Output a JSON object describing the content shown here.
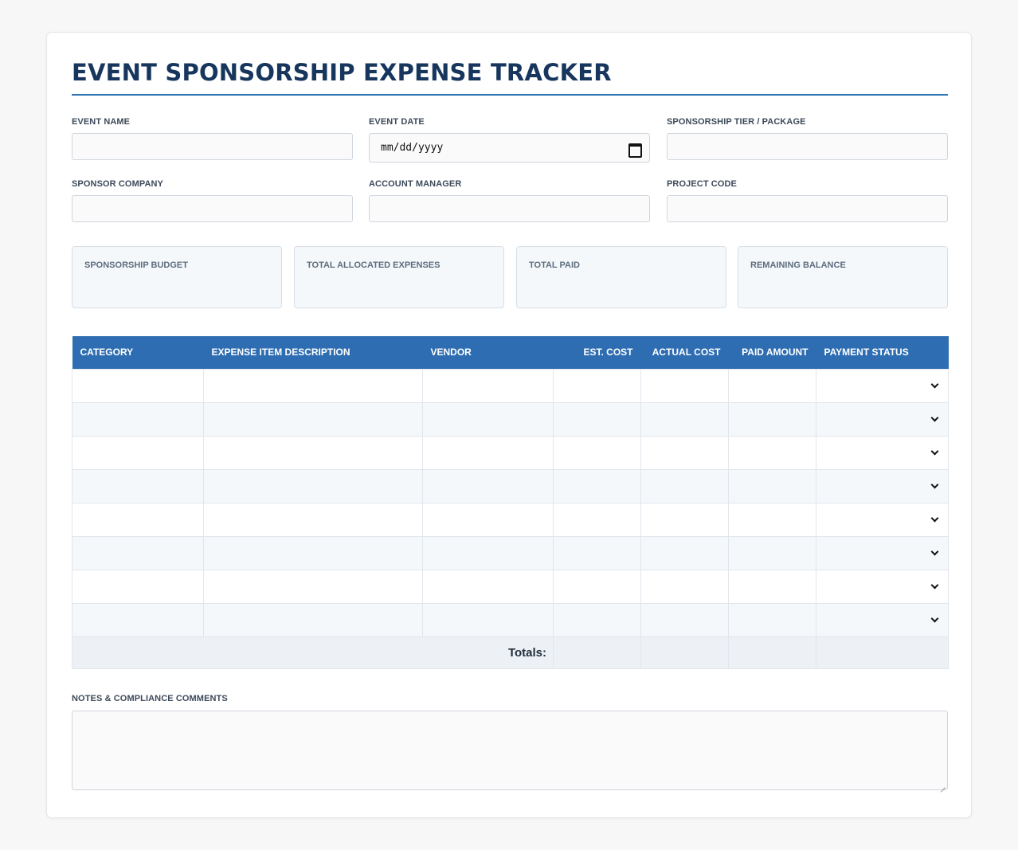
{
  "title": "EVENT SPONSORSHIP EXPENSE TRACKER",
  "fields": {
    "event_name": {
      "label": "EVENT NAME",
      "value": ""
    },
    "event_date": {
      "label": "EVENT DATE",
      "placeholder": "mm/dd/yyyy"
    },
    "tier": {
      "label": "SPONSORSHIP TIER / PACKAGE",
      "value": ""
    },
    "sponsor_company": {
      "label": "SPONSOR COMPANY",
      "value": ""
    },
    "account_manager": {
      "label": "ACCOUNT MANAGER",
      "value": ""
    },
    "project_code": {
      "label": "PROJECT CODE",
      "value": ""
    }
  },
  "summary": [
    {
      "label": "SPONSORSHIP BUDGET",
      "value": ""
    },
    {
      "label": "TOTAL ALLOCATED EXPENSES",
      "value": ""
    },
    {
      "label": "TOTAL PAID",
      "value": ""
    },
    {
      "label": "REMAINING BALANCE",
      "value": ""
    }
  ],
  "table": {
    "headers": [
      "CATEGORY",
      "EXPENSE ITEM DESCRIPTION",
      "VENDOR",
      "EST. COST",
      "ACTUAL COST",
      "PAID AMOUNT",
      "PAYMENT STATUS"
    ],
    "totals_label": "Totals:"
  },
  "notes": {
    "label": "NOTES & COMPLIANCE COMMENTS",
    "value": ""
  },
  "icons": {
    "date": "calendar-icon",
    "select": "chevron-down-icon",
    "textarea": "resize-grip-icon"
  }
}
